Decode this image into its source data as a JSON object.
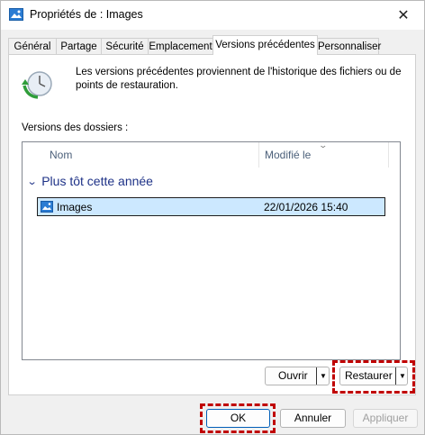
{
  "window": {
    "title": "Propriétés de : Images"
  },
  "tabs": [
    {
      "label": "Général"
    },
    {
      "label": "Partage"
    },
    {
      "label": "Sécurité"
    },
    {
      "label": "Emplacement"
    },
    {
      "label": "Versions précédentes"
    },
    {
      "label": "Personnaliser"
    }
  ],
  "active_tab": "Versions précédentes",
  "info_text": "Les versions précédentes proviennent de l'historique des fichiers ou de points de restauration.",
  "section_label": "Versions des dossiers :",
  "columns": {
    "name": "Nom",
    "modified": "Modifié le"
  },
  "group": {
    "label": "Plus tôt cette année"
  },
  "rows": [
    {
      "name": "Images",
      "modified": "22/01/2026 15:40",
      "selected": true
    }
  ],
  "buttons": {
    "open": "Ouvrir",
    "restore": "Restaurer",
    "ok": "OK",
    "cancel": "Annuler",
    "apply": "Appliquer"
  },
  "highlight_color": "#c00000",
  "selection_color": "#cce8ff",
  "icons": [
    "folder-images-icon",
    "close-icon",
    "restore-clock-icon",
    "chevron-down-icon"
  ]
}
